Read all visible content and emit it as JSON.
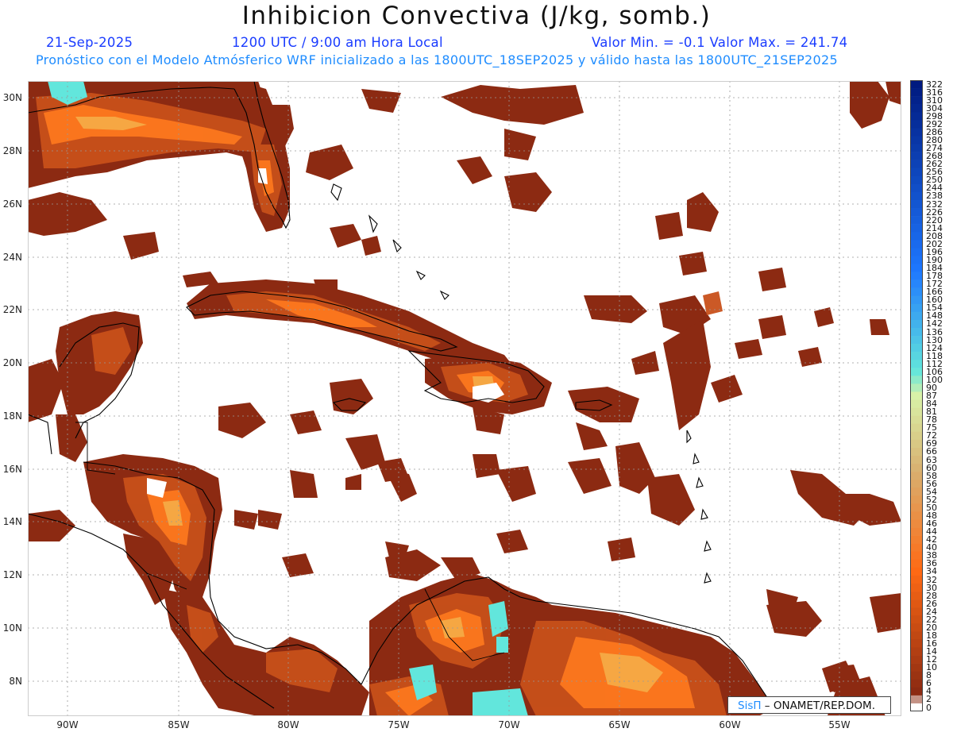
{
  "title": "Inhibicion Convectiva (J/kg, somb.)",
  "header": {
    "date": "21-Sep-2025",
    "time": "1200 UTC / 9:00 am Hora Local",
    "minmax": "Valor Min. = -0.1  Valor Max. = 241.74",
    "subtitle": "Pronóstico con el Modelo Atmósferico WRF inicializado a las 1800UTC_18SEP2025 y válido hasta las  1800UTC_21SEP2025"
  },
  "axes": {
    "lat_labels": [
      "30N",
      "28N",
      "26N",
      "24N",
      "22N",
      "20N",
      "18N",
      "16N",
      "14N",
      "12N",
      "10N",
      "8N"
    ],
    "lon_labels": [
      "90W",
      "85W",
      "80W",
      "75W",
      "70W",
      "65W",
      "60W",
      "55W"
    ]
  },
  "colorbar": {
    "labels": [
      "322",
      "316",
      "310",
      "304",
      "298",
      "292",
      "286",
      "280",
      "274",
      "268",
      "262",
      "256",
      "250",
      "244",
      "238",
      "232",
      "226",
      "220",
      "214",
      "208",
      "202",
      "196",
      "190",
      "184",
      "178",
      "172",
      "166",
      "160",
      "154",
      "148",
      "142",
      "136",
      "130",
      "124",
      "118",
      "112",
      "106",
      "100",
      "90",
      "87",
      "84",
      "81",
      "78",
      "75",
      "72",
      "69",
      "66",
      "63",
      "60",
      "58",
      "56",
      "54",
      "52",
      "50",
      "48",
      "46",
      "44",
      "42",
      "40",
      "38",
      "36",
      "34",
      "32",
      "30",
      "28",
      "26",
      "24",
      "22",
      "20",
      "18",
      "16",
      "14",
      "12",
      "10",
      "8",
      "6",
      "4",
      "2",
      "0"
    ],
    "colors": {
      "dark_blue": "#001a80",
      "blue": "#1e78ff",
      "cyan": "#62e6dc",
      "light_green": "#d8f2a8",
      "tan": "#d8b070",
      "orange": "#ff6a14",
      "brown": "#8c2a12",
      "white": "#ffffff"
    }
  },
  "credit": {
    "brand": "SisΠ",
    "text": " – ONAMET/REP.DOM."
  },
  "colors": {
    "cin_low": "#8c2a12",
    "cin_mid": "#c8501a",
    "cin_high": "#ff7a1e",
    "cin_peak": "#f4b04a",
    "cin_extreme": "#62e6dc",
    "coast": "#000000",
    "grid": "#999999"
  }
}
